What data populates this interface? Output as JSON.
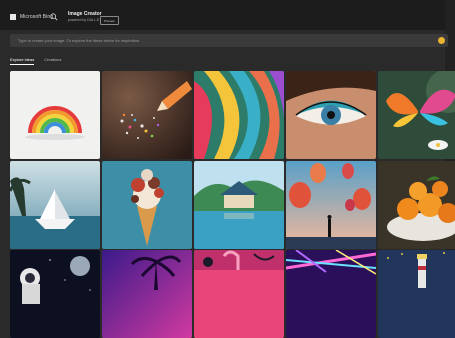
{
  "header": {
    "brand": "Microsoft Bing",
    "app_title": "Image Creator",
    "app_subtitle": "powered by DALL-E",
    "pill_label": "Preview"
  },
  "prompt": {
    "placeholder": "Type to create your image. Or explore the ideas below for inspiration."
  },
  "coins": {
    "count": ""
  },
  "tabs": [
    {
      "label": "Explore ideas",
      "active": true
    },
    {
      "label": "Creations",
      "active": false
    }
  ],
  "gallery": [
    {
      "subject": "rainbow"
    },
    {
      "subject": "pencil-confetti"
    },
    {
      "subject": "paint-waves"
    },
    {
      "subject": "eye-makeup"
    },
    {
      "subject": "butterfly"
    },
    {
      "subject": "paper-boat"
    },
    {
      "subject": "ice-cream"
    },
    {
      "subject": "lake-house"
    },
    {
      "subject": "balloons"
    },
    {
      "subject": "oranges"
    },
    {
      "subject": "astronaut"
    },
    {
      "subject": "palm-sunset"
    },
    {
      "subject": "flamingo"
    },
    {
      "subject": "neon-lights"
    },
    {
      "subject": "lighthouse"
    }
  ]
}
